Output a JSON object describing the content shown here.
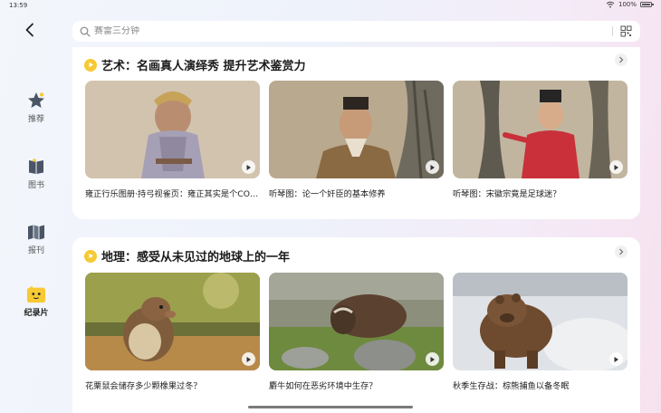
{
  "status": {
    "time": "13:59",
    "battery": "100%"
  },
  "search": {
    "placeholder": "赛雷三分钟"
  },
  "sidebar": {
    "items": [
      {
        "label": "推荐",
        "icon": "star-icon"
      },
      {
        "label": "图书",
        "icon": "book-icon"
      },
      {
        "label": "报刊",
        "icon": "newspaper-icon"
      },
      {
        "label": "纪录片",
        "icon": "documentary-icon",
        "active": true
      }
    ]
  },
  "sections": [
    {
      "title": "艺术：名画真人演绎秀 提升艺术鉴赏力",
      "videos": [
        {
          "title": "雍正行乐图册·持弓视雀页：雍正其实是个COS…"
        },
        {
          "title": "听琴图：论一个奸臣的基本修养"
        },
        {
          "title": "听琴图：宋徽宗竟是足球迷？"
        }
      ]
    },
    {
      "title": "地理：感受从未见过的地球上的一年",
      "videos": [
        {
          "title": "花栗鼠会储存多少颗橡果过冬？"
        },
        {
          "title": "麝牛如何在恶劣环境中生存？"
        },
        {
          "title": "秋季生存战：棕熊捕鱼以备冬眠"
        }
      ]
    }
  ],
  "colors": {
    "accent": "#f7c934",
    "card": "#ffffff"
  }
}
